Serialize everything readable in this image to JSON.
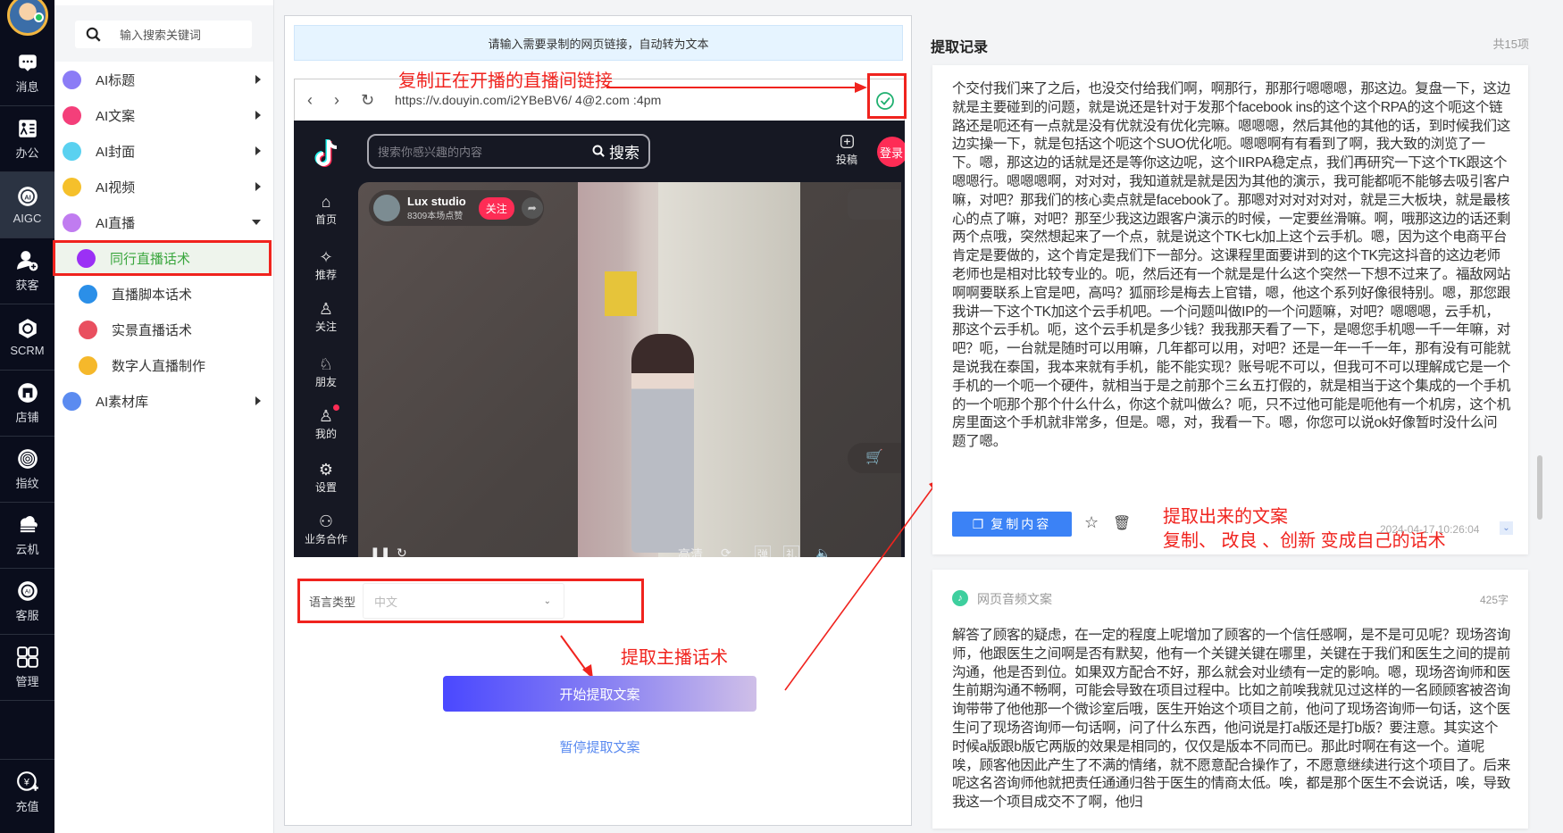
{
  "rail": {
    "items": [
      {
        "label": "消息",
        "icon": "message-icon"
      },
      {
        "label": "办公",
        "icon": "office-icon"
      },
      {
        "label": "AIGC",
        "icon": "ai-icon",
        "active": true
      },
      {
        "label": "获客",
        "icon": "user-add-icon"
      },
      {
        "label": "SCRM",
        "icon": "scrm-icon"
      },
      {
        "label": "店铺",
        "icon": "shop-icon"
      },
      {
        "label": "指纹",
        "icon": "fingerprint-icon"
      },
      {
        "label": "云机",
        "icon": "cloud-machine-icon"
      },
      {
        "label": "客服",
        "icon": "support-icon"
      },
      {
        "label": "管理",
        "icon": "grid-icon"
      }
    ],
    "recharge": "充值"
  },
  "menu": {
    "search_placeholder": "输入搜索关键词",
    "items": [
      {
        "label": "AI标题",
        "color": "#8b7cf6"
      },
      {
        "label": "AI文案",
        "color": "#f43f7a"
      },
      {
        "label": "AI封面",
        "color": "#5ad1f0"
      },
      {
        "label": "AI视频",
        "color": "#f5c02b"
      },
      {
        "label": "AI直播",
        "color": "#c07cf0"
      }
    ],
    "sub_items": [
      {
        "label": "同行直播话术",
        "color": "#9b30f5",
        "selected": true
      },
      {
        "label": "直播脚本话术",
        "color": "#2b8fe8"
      },
      {
        "label": "实景直播话术",
        "color": "#e94f5f"
      },
      {
        "label": "数字人直播制作",
        "color": "#f5b82b"
      }
    ],
    "last_item": {
      "label": "AI素材库",
      "color": "#5b8bf0"
    }
  },
  "center": {
    "notice": "请输入需要录制的网页链接，自动转为文本",
    "url": "https://v.douyin.com/i2YBeBV6/ 4@2.com :4pm",
    "douyin": {
      "search_placeholder": "搜索你感兴趣的内容",
      "search_btn": "搜索",
      "upload": "投稿",
      "login": "登录",
      "nav": [
        "首页",
        "推荐",
        "关注",
        "朋友",
        "我的",
        "设置",
        "业务合作"
      ],
      "host_name": "Lux studio",
      "host_likes": "8309本场点赞",
      "follow": "关注",
      "quality": "高清",
      "danmu": "弹",
      "gift": "礼"
    },
    "lang_label": "语言类型",
    "lang_value": "中文",
    "start_btn": "开始提取文案",
    "pause_btn": "暂停提取文案"
  },
  "annotations": {
    "copy_link": "复制正在开播的直播间链接",
    "extract": "提取主播话术",
    "result1": "提取出来的文案",
    "result2": "复制、 改良 、创新 变成自己的话术"
  },
  "records": {
    "title": "提取记录",
    "count": "共15项",
    "card1": {
      "text": "个交付我们来了之后，也没交付给我们啊，啊那行，那那行嗯嗯嗯，那这边。复盘一下，这边就是主要碰到的问题，就是说还是针对于发那个facebook ins的这个这个RPA的这个呃这个链路还是呃还有一点就是没有优就没有优化完嘛。嗯嗯嗯，然后其他的其他的话，到时候我们这边实操一下，就是包括这个呃这个SUO优化呃。嗯嗯啊有有看到了啊，我大致的浏览了一下。嗯，那这边的话就是还是等你这边呢，这个IIRPA稳定点，我们再研究一下这个TK跟这个嗯嗯行。嗯嗯嗯啊，对对对，我知道就是就是因为其他的演示，我可能都呃不能够去吸引客户嘛，对吧？那我们的核心卖点就是facebook了。那嗯对对对对对对，就是三大板块，就是最核心的点了嘛，对吧？那至少我这边跟客户演示的时候，一定要丝滑嘛。啊，哦那这边的话还剩两个点哦，突然想起来了一个点，就是说这个TK七k加上这个云手机。嗯，因为这个电商平台肯定是要做的，这个肯定是我们下一部分。这课程里面要讲到的这个TK完这抖音的这边老师老师也是相对比较专业的。呃，然后还有一个就是是什么这个突然一下想不过来了。福敌网站啊啊要联系上官是吧，高吗？狐丽珍是梅去上官错，嗯，他这个系列好像很特别。嗯，那您跟我讲一下这个TK加这个云手机吧。一个问题叫做IP的一个问题嘛，对吧？嗯嗯嗯，云手机，那这个云手机。呃，这个云手机是多少钱？我我那天看了一下，是嗯您手机嗯一千一年嘛，对吧？呃，一台就是随时可以用嘛，几年都可以用，对吧？还是一年一千一年，那有没有可能就是说我在泰国，我本来就有手机，能不能实现？账号呢不可以，但我可不可以理解成它是一个手机的一个呃一个硬件，就相当于是之前那个三幺五打假的，就是相当于这个集成的一个手机的一个呃那个那个什么什么，你这个就叫做么？呃，只不过他可能是呃他有一个机房，这个机房里面这个手机就非常多，但是。嗯，对，我看一下。嗯，你您可以说ok好像暂时没什么问题了嗯。",
      "copy_btn": "复制内容",
      "date": "2024-04-17 10:26:04"
    },
    "card2": {
      "source": "网页音频文案",
      "chars": "425字",
      "text": "解答了顾客的疑虑，在一定的程度上呢增加了顾客的一个信任感啊，是不是可见呢？现场咨询师，他跟医生之间啊是否有默契，他有一个关键关键在哪里，关键在于我们和医生之间的提前沟通，他是否到位。如果双方配合不好，那么就会对业绩有一定的影响。嗯，现场咨询师和医生前期沟通不畅啊，可能会导致在项目过程中。比如之前唉我就见过这样的一名顾顾客被咨询询带带了他他那一个微诊室后哦，医生开始这个项目之前，他问了现场咨询师一句话，这个医生问了现场咨询师一句话啊，问了什么东西，他问说是打a版还是打b版？要注意。其实这个时候a版跟b版它两版的效果是相同的，仅仅是版本不同而已。那此时啊在有这一个。道呢唉，顾客他因此产生了不满的情绪，就不愿意配合操作了，不愿意继续进行这个项目了。后来呢这名咨询师他就把责任通通归咎于医生的情商太低。唉，都是那个医生不会说话，唉，导致我这一个项目成交不了啊，他归"
    }
  }
}
